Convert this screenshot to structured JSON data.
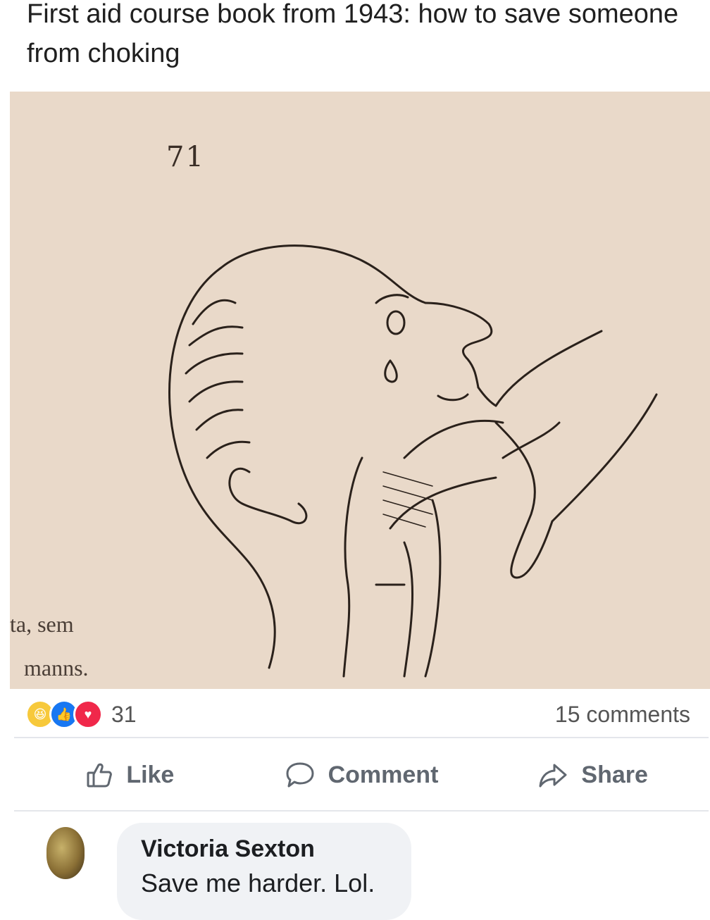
{
  "post": {
    "text": "First aid course book from 1943: how to save someone from choking"
  },
  "photo": {
    "page_number": "71",
    "book_text_line1": "ta,   sem",
    "book_text_line2": "manns."
  },
  "reactions": {
    "icons": [
      "haha-icon",
      "like-icon",
      "love-icon"
    ],
    "count": "31",
    "comments_count": "15 comments"
  },
  "actions": {
    "like_label": "Like",
    "comment_label": "Comment",
    "share_label": "Share"
  },
  "comment": {
    "author": "Victoria Sexton",
    "text": "Save me harder. Lol."
  },
  "colors": {
    "like_blue": "#1877f2",
    "love_red": "#f0284a",
    "haha_yellow": "#f7c93b",
    "paper": "#e9d9c9",
    "bubble": "#f0f2f5"
  }
}
